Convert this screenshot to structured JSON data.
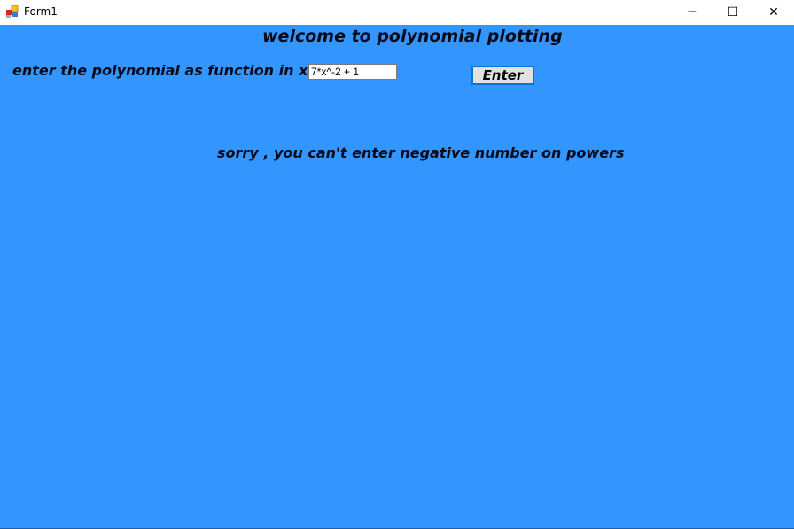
{
  "window": {
    "title": "Form1",
    "minimize_glyph": "─",
    "maximize_glyph": "☐",
    "close_glyph": "✕"
  },
  "form": {
    "heading": "welcome to polynomial plotting",
    "prompt_label": "enter the polynomial as function in x",
    "polynomial_value": "7*x^-2 + 1",
    "enter_label": "Enter",
    "error_message": "sorry , you can't enter negative number on powers"
  },
  "colors": {
    "background": "#3396ff",
    "button_border": "#0078d7"
  }
}
